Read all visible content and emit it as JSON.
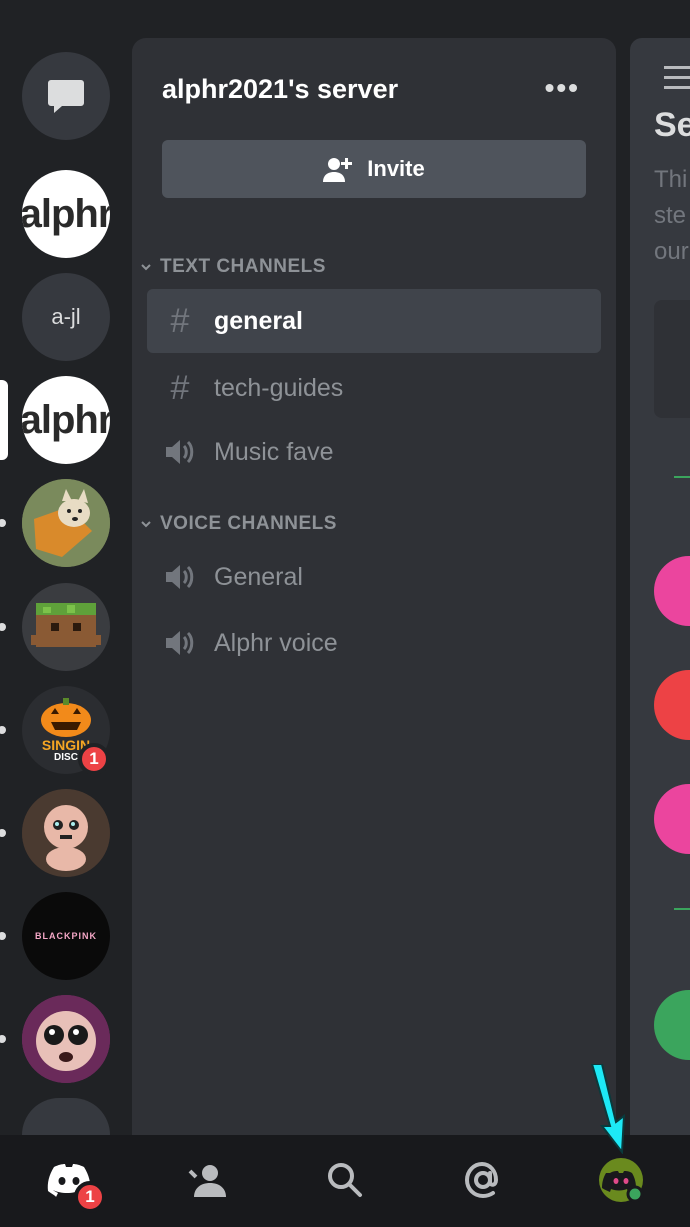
{
  "sidebar": {
    "servers": [
      {
        "label": "",
        "kind": "dm-icon"
      },
      {
        "label": "alphr",
        "kind": "alphr"
      },
      {
        "label": "a-jl",
        "kind": "text"
      },
      {
        "label": "alphr",
        "kind": "alphr",
        "selected": true
      },
      {
        "label": "",
        "kind": "dog-avatar"
      },
      {
        "label": "",
        "kind": "minecraft-avatar"
      },
      {
        "label": "SINGIN",
        "sublabel": "DISC",
        "kind": "pumpkin-avatar",
        "badge": "1"
      },
      {
        "label": "",
        "kind": "isaac-avatar"
      },
      {
        "label": "BLACKPINK",
        "kind": "blackpink-avatar"
      },
      {
        "label": "",
        "kind": "crying-avatar"
      }
    ]
  },
  "channel_panel": {
    "server_name": "alphr2021's server",
    "more_label": "•••",
    "invite_label": "Invite",
    "categories": [
      {
        "title": "TEXT CHANNELS",
        "channels": [
          {
            "name": "general",
            "type": "text",
            "active": true
          },
          {
            "name": "tech-guides",
            "type": "text"
          },
          {
            "name": "Music fave",
            "type": "voice"
          }
        ]
      },
      {
        "title": "VOICE CHANNELS",
        "channels": [
          {
            "name": "General",
            "type": "voice"
          },
          {
            "name": "Alphr voice",
            "type": "voice"
          }
        ]
      }
    ]
  },
  "peek": {
    "title_fragment": "Se",
    "lines": [
      "Thi",
      "ste",
      "our"
    ]
  },
  "bottom_nav": {
    "tabs": [
      "home-icon",
      "friends-icon",
      "search-icon",
      "mentions-icon",
      "profile-icon"
    ],
    "home_badge": "1"
  },
  "colors": {
    "background": "#202225",
    "panel": "#2f3136",
    "active_channel": "#40444b",
    "invite_button": "#4f545c",
    "badge": "#ed4245",
    "annotation_arrow": "#1de9f6"
  }
}
